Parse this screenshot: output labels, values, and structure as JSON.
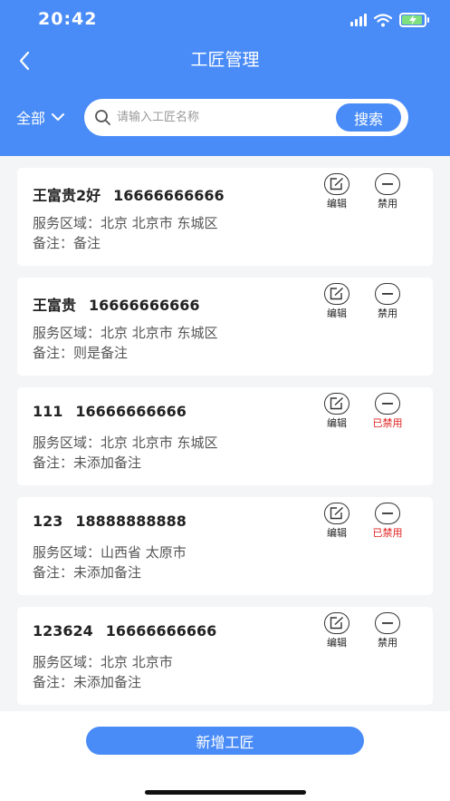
{
  "status": {
    "time": "20:42"
  },
  "header": {
    "title": "工匠管理"
  },
  "filter": {
    "label": "全部"
  },
  "search": {
    "placeholder": "请输入工匠名称",
    "button_label": "搜索"
  },
  "colors": {
    "primary": "#4a8cf7",
    "disabled_text": "#e02020",
    "battery": "#7fe07f"
  },
  "icons": {
    "back": "chevron-left-icon",
    "dropdown": "chevron-down-icon",
    "search": "search-icon",
    "edit": "edit-icon",
    "disable": "minus-circle-icon"
  },
  "actions": {
    "edit_label": "编辑"
  },
  "workers": [
    {
      "name": "王富贵2好",
      "phone": "16666666666",
      "area": "服务区域：北京 北京市 东城区",
      "note": "备注：备注",
      "status_label": "禁用",
      "disabled": false
    },
    {
      "name": "王富贵",
      "phone": "16666666666",
      "area": "服务区域：北京 北京市 东城区",
      "note": "备注：则是备注",
      "status_label": "禁用",
      "disabled": false
    },
    {
      "name": "111",
      "phone": "16666666666",
      "area": "服务区域：北京 北京市 东城区",
      "note": "备注：未添加备注",
      "status_label": "已禁用",
      "disabled": true
    },
    {
      "name": "123",
      "phone": "18888888888",
      "area": "服务区域：山西省 太原市",
      "note": "备注：未添加备注",
      "status_label": "已禁用",
      "disabled": true
    },
    {
      "name": "123624",
      "phone": "16666666666",
      "area": "服务区域：北京 北京市",
      "note": "备注：未添加备注",
      "status_label": "禁用",
      "disabled": false
    }
  ],
  "footer": {
    "add_label": "新增工匠"
  }
}
